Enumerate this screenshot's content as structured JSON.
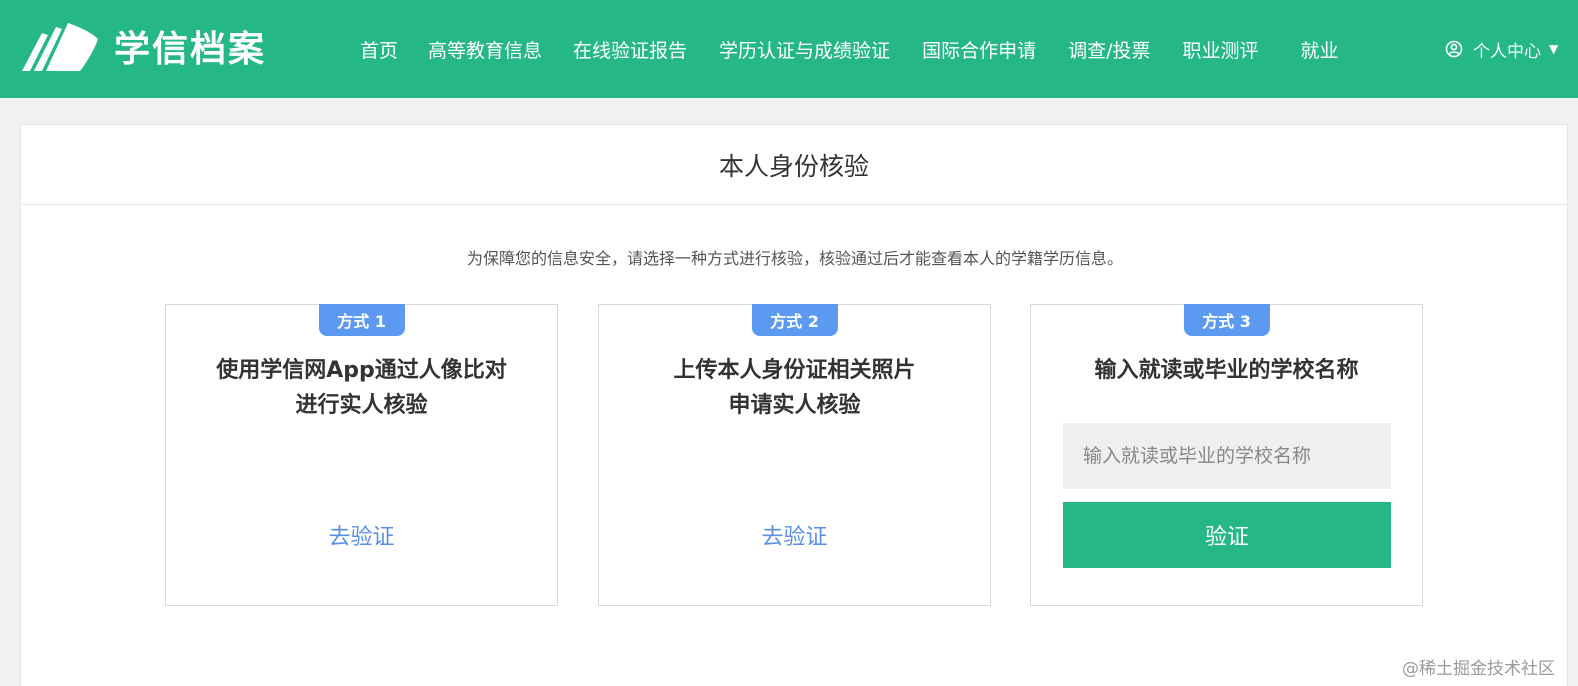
{
  "header": {
    "logo_text": "学信档案",
    "nav": [
      {
        "label": "首页"
      },
      {
        "label": "高等教育信息"
      },
      {
        "label": "在线验证报告"
      },
      {
        "label": "学历认证与成绩验证"
      },
      {
        "label": "国际合作申请"
      },
      {
        "label": "调查/投票"
      },
      {
        "label": "职业测评"
      },
      {
        "label": "就业"
      }
    ],
    "user_menu": {
      "label": "个人中心",
      "icon": "user-circle-icon",
      "caret_icon": "caret-down-icon"
    }
  },
  "page": {
    "title": "本人身份核验",
    "notice": "为保障您的信息安全，请选择一种方式进行核验，核验通过后才能查看本人的学籍学历信息。"
  },
  "methods": [
    {
      "badge": "方式 1",
      "title_line1": "使用学信网App通过人像比对",
      "title_line2": "进行实人核验",
      "link": "去验证"
    },
    {
      "badge": "方式 2",
      "title_line1": "上传本人身份证相关照片",
      "title_line2": "申请实人核验",
      "link": "去验证"
    },
    {
      "badge": "方式 3",
      "title_line1": "输入就读或毕业的学校名称",
      "input_placeholder": "输入就读或毕业的学校名称",
      "input_value": "",
      "button": "验证"
    }
  ],
  "watermark": "@稀土掘金技术社区",
  "colors": {
    "brand": "#25b884",
    "badge": "#5c9af2",
    "link": "#5a8fe6",
    "background": "#f1f1f1"
  }
}
